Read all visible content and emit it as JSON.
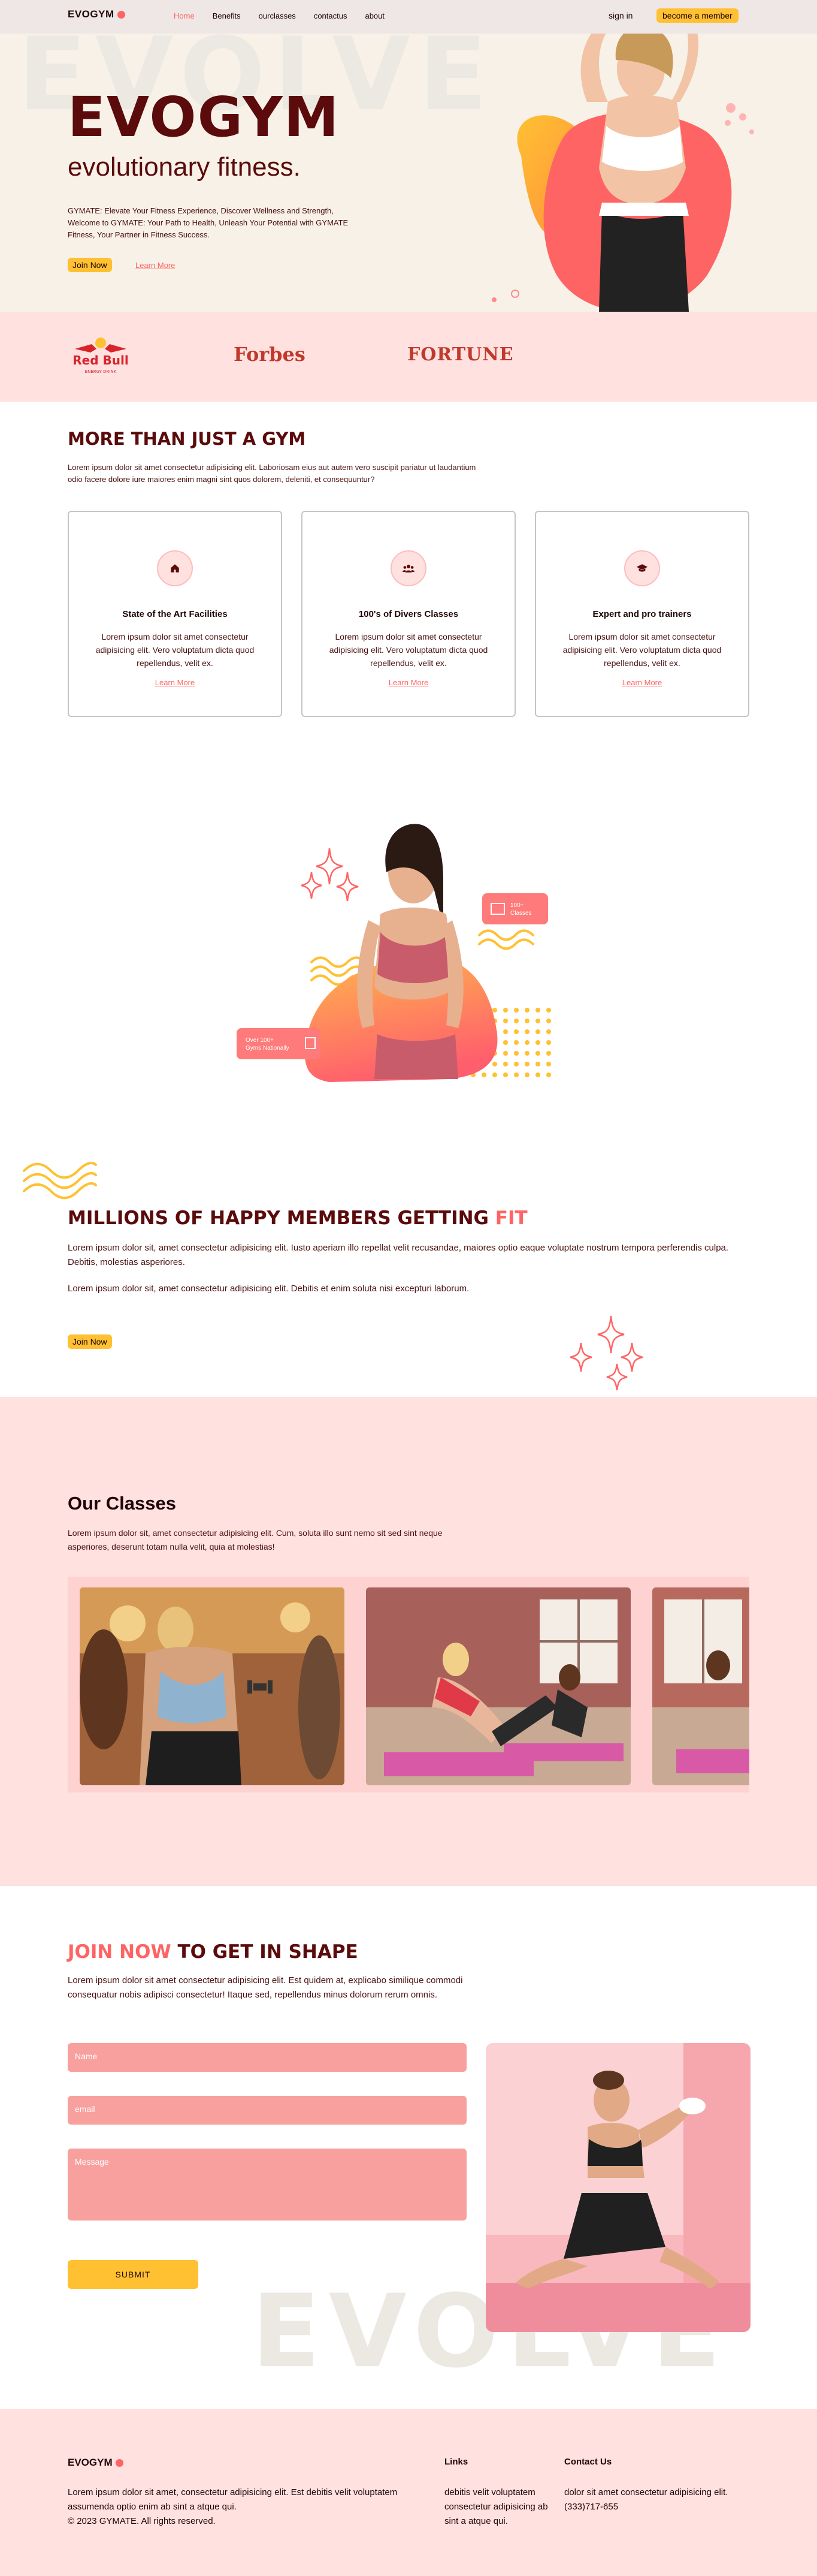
{
  "nav": {
    "logo": "EVOGYM",
    "links": [
      "Home",
      "Benefits",
      "ourclasses",
      "contactus",
      "about"
    ],
    "active_link": "Home",
    "signin": "sign in",
    "become_member": "become a member"
  },
  "hero": {
    "watermark": "EVOLVE",
    "title": "EVOGYM",
    "subtitle": "evolutionary fitness.",
    "description": "GYMATE: Elevate Your Fitness Experience, Discover Wellness and Strength, Welcome to GYMATE: Your Path to Health, Unleash Your Potential with GYMATE Fitness, Your Partner in Fitness Success.",
    "join_label": "Join Now",
    "learn_label": "Learn More"
  },
  "sponsors": {
    "redbull_main": "Red Bull",
    "redbull_sub": "ENERGY DRINK",
    "forbes": "Forbes",
    "fortune": "FORTUNE"
  },
  "benefits": {
    "heading": "MORE THAN JUST A GYM",
    "text": "Lorem ipsum dolor sit amet consectetur adipisicing elit. Laboriosam eius aut autem vero suscipit pariatur ut laudantium odio facere dolore iure maiores enim magni sint quos dolorem, deleniti, et consequuntur?",
    "cards": [
      {
        "icon": "home-icon",
        "title": "State of the Art Facilities",
        "text": "Lorem ipsum dolor sit amet consectetur adipisicing elit. Vero voluptatum dicta quod repellendus, velit ex.",
        "link": "Learn More"
      },
      {
        "icon": "users-icon",
        "title": "100's of Divers Classes",
        "text": "Lorem ipsum dolor sit amet consectetur adipisicing elit. Vero voluptatum dicta quod repellendus, velit ex.",
        "link": "Learn More"
      },
      {
        "icon": "graduation-cap-icon",
        "title": "Expert and pro trainers",
        "text": "Lorem ipsum dolor sit amet consectetur adipisicing elit. Vero voluptatum dicta quod repellendus, velit ex.",
        "link": "Learn More"
      }
    ]
  },
  "members": {
    "heading_a": "MILLIONS OF HAPPY MEMBERS GETTING ",
    "heading_b": "FIT",
    "p1": "Lorem ipsum dolor sit, amet consectetur adipisicing elit. Iusto aperiam illo repellat velit recusandae, maiores optio eaque voluptate nostrum tempora perferendis culpa. Debitis, molestias asperiores.",
    "p2": "Lorem ipsum dolor sit, amet consectetur adipisicing elit. Debitis et enim soluta nisi excepturi laborum.",
    "join_label": "Join Now",
    "badge_classes_num": "100+",
    "badge_classes_label": "Classes",
    "badge_gyms_line1": "Over 100+",
    "badge_gyms_line2": "Gyms Nationally"
  },
  "classes": {
    "heading": "Our Classes",
    "text": "Lorem ipsum dolor sit, amet consectetur adipisicing elit. Cum, soluta illo sunt nemo sit sed sint neque asperiores, deserunt totam nulla velit, quia at molestias!"
  },
  "join": {
    "heading_a": "JOIN NOW",
    "heading_b": " TO GET IN SHAPE",
    "text": "Lorem ipsum dolor sit amet consectetur adipisicing elit. Est quidem at, explicabo similique commodi consequatur nobis adipisci consectetur! Itaque sed, repellendus minus dolorum rerum omnis.",
    "name_placeholder": "Name",
    "email_placeholder": "email",
    "message_placeholder": "Message",
    "submit": "SUBMIT",
    "watermark": "EVOLVE"
  },
  "footer": {
    "logo": "EVOGYM",
    "text": "Lorem ipsum dolor sit amet, consectetur adipisicing elit. Est debitis velit voluptatem assumenda optio enim ab sint a atque qui.",
    "copyright": "© 2023 GYMATE. All rights reserved.",
    "links_title": "Links",
    "links_text": "debitis velit voluptatem consectetur adipisicing ab sint a atque qui.",
    "contact_title": "Contact Us",
    "contact_text": "dolor sit amet consectetur adipisicing elit.",
    "phone": "(333)717-655"
  },
  "colors": {
    "accent": "#ff6464",
    "yellow": "#ffc132",
    "dark_red": "#5b0b0b",
    "pink_bg": "#ffe1e0",
    "cream_bg": "#f7f1e8"
  }
}
